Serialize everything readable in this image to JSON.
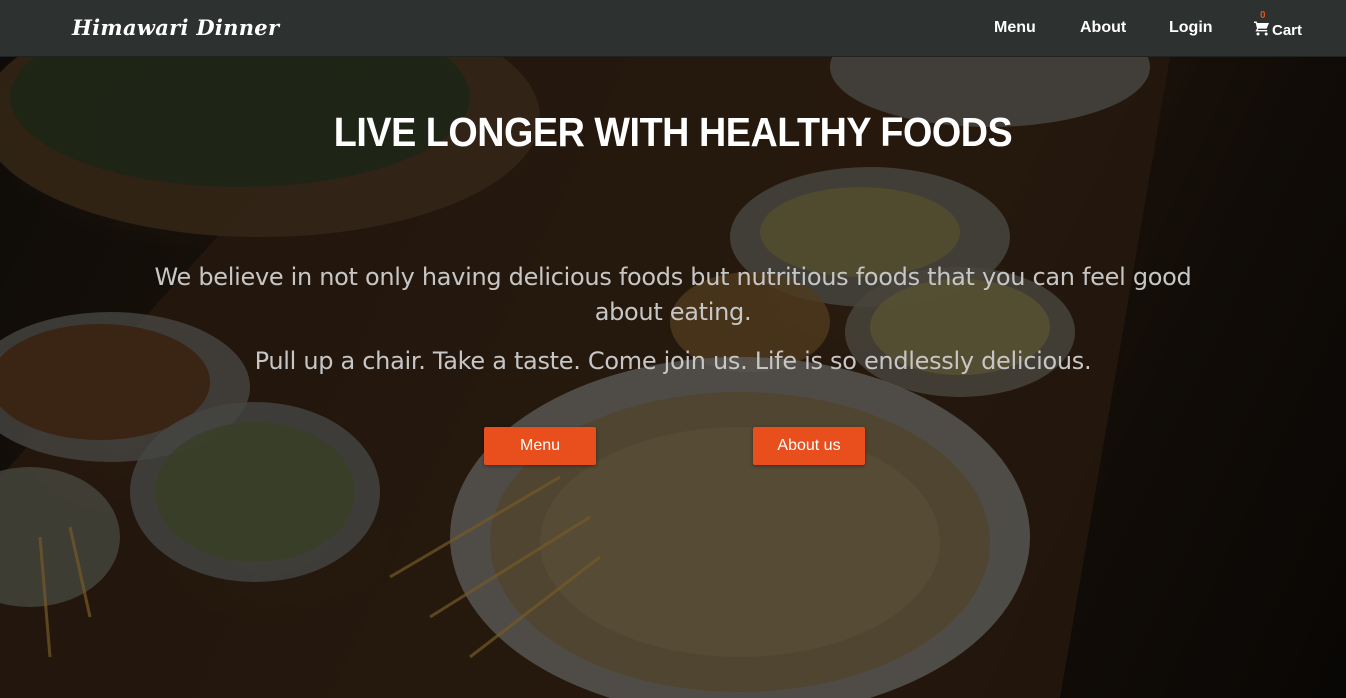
{
  "brand": "Himawari Dinner",
  "nav": {
    "menu": "Menu",
    "about": "About",
    "login": "Login",
    "cart_label": "Cart",
    "cart_count": "0",
    "cart_icon": "cart-icon"
  },
  "hero": {
    "headline": "LIVE LONGER WITH HEALTHY FOODS",
    "tagline": "We believe in not only having delicious foods but nutritious foods that you can feel good about eating.",
    "subline": "Pull up a chair. Take a taste. Come join us. Life is so endlessly delicious.",
    "menu_button": "Menu",
    "about_button": "About us"
  },
  "colors": {
    "navbar": "#2d312f",
    "accent": "#e84f1c",
    "text": "#ffffff",
    "body_text": "#c6c6c6"
  }
}
